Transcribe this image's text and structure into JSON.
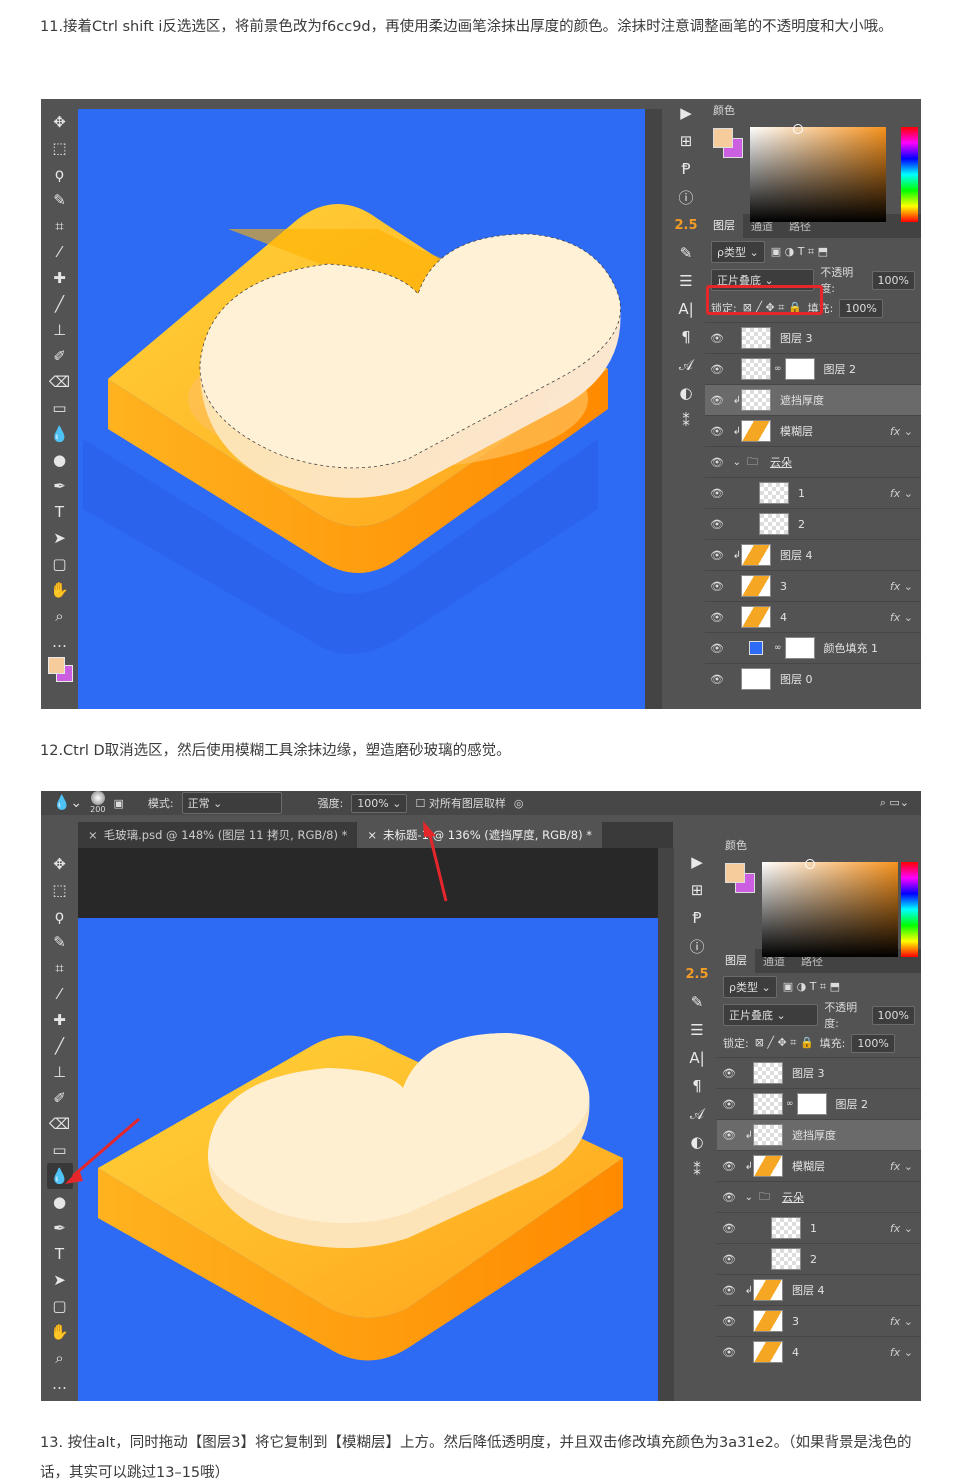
{
  "step11": {
    "text": "11.接着Ctrl shift i反选选区，将前景色改为f6cc9d，再使用柔边画笔涂抹出厚度的颜色。涂抹时注意调整画笔的不透明度和大小哦。"
  },
  "step12": {
    "text": "12.Ctrl D取消选区，然后使用模糊工具涂抹边缘，塑造磨砂玻璃的感觉。"
  },
  "step13": {
    "text": "13. 按住alt，同时拖动【图层3】将它复制到【模糊层】上方。然后降低透明度，并且双击修改填充颜色为3a31e2。（如果背景是浅色的话，其实可以跳过13–15哦）"
  },
  "colors": {
    "foreground": "#f6cc9d",
    "background": "#cc5ee2",
    "canvas": "#2e6bf5",
    "accent": "#f49b25",
    "highlight": "#e5262b"
  },
  "tools": [
    "move-icon",
    "marquee-icon",
    "lasso-icon",
    "quick-select-icon",
    "crop-icon",
    "eyedropper-icon",
    "healing-icon",
    "brush-icon",
    "stamp-icon",
    "history-brush-icon",
    "eraser-icon",
    "gradient-icon",
    "blur-icon",
    "dodge-icon",
    "pen-icon",
    "type-icon",
    "path-select-icon",
    "shape-icon",
    "hand-icon",
    "zoom-icon",
    "more-icon"
  ],
  "strip": {
    "num": "2.5"
  },
  "panel": {
    "color_tab": "颜色",
    "tabs": [
      "图层",
      "通道",
      "路径"
    ],
    "filter": "ρ类型",
    "blend": "正片叠底",
    "opacity_label": "不透明度:",
    "opacity": "100%",
    "lock_label": "锁定:",
    "fill_label": "填充:",
    "fill": "100%"
  },
  "layers": [
    {
      "name": "图层 3",
      "thumb": "checker"
    },
    {
      "name": "图层 2",
      "thumb": "checker",
      "mask": true
    },
    {
      "name": "遮挡厚度",
      "thumb": "checker",
      "clip": true,
      "hl": true
    },
    {
      "name": "模糊层",
      "thumb": "ora",
      "clip": true,
      "fx": "fx"
    },
    {
      "name": "云朵",
      "group": true
    },
    {
      "name": "1",
      "thumb": "checker",
      "indent": true,
      "fx": "fx"
    },
    {
      "name": "2",
      "thumb": "checker",
      "indent": true
    },
    {
      "name": "图层 4",
      "thumb": "ora",
      "clip": true
    },
    {
      "name": "3",
      "thumb": "ora",
      "fx": "fx"
    },
    {
      "name": "4",
      "thumb": "ora",
      "fx": "fx"
    },
    {
      "name": "颜色填充 1",
      "thumb": "blue",
      "mask": true
    },
    {
      "name": "图层 0",
      "thumb": "white"
    }
  ],
  "options": {
    "brush_size": "200",
    "mode_label": "模式:",
    "mode": "正常",
    "strength_label": "强度:",
    "strength": "100%",
    "sample_all": "对所有图层取样"
  },
  "docs": [
    "毛玻璃.psd @ 148% (图层 11 拷贝, RGB/8) *",
    "未标题-1 @ 136% (遮挡厚度, RGB/8) *"
  ]
}
